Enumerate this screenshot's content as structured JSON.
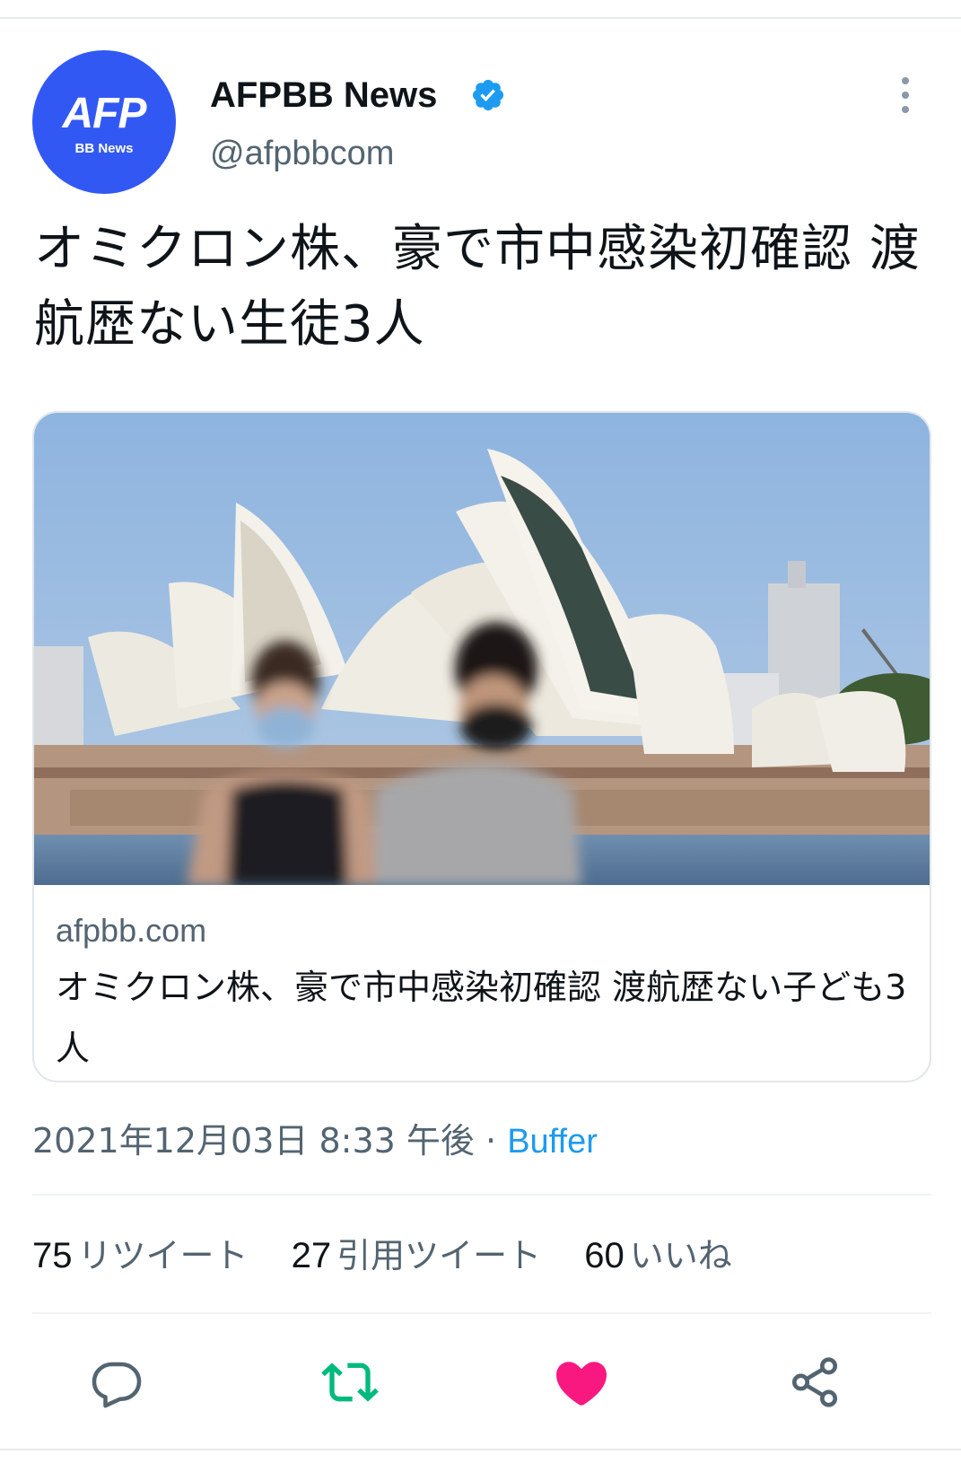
{
  "account": {
    "display_name": "AFPBB News",
    "handle": "@afpbbcom",
    "avatar_logo": "AFP",
    "avatar_sub": "BB News",
    "verified": true,
    "avatar_color": "#3258f4"
  },
  "tweet": {
    "text": "オミクロン株、豪で市中感染初確認 渡航歴ない生徒3人"
  },
  "card": {
    "domain": "afpbb.com",
    "title": "オミクロン株、豪で市中感染初確認 渡航歴ない子ども3人"
  },
  "meta": {
    "timestamp": "2021年12月03日 8:33 午後",
    "separator": "·",
    "source": "Buffer"
  },
  "stats": {
    "retweets": {
      "count": "75",
      "label": "リツイート"
    },
    "quotes": {
      "count": "27",
      "label": "引用ツイート"
    },
    "likes": {
      "count": "60",
      "label": "いいね"
    }
  },
  "actions": [
    {
      "name": "reply",
      "icon": "reply-icon",
      "color": "#536471"
    },
    {
      "name": "retweet",
      "icon": "retweet-icon",
      "color": "#00ba7c"
    },
    {
      "name": "like",
      "icon": "heart-icon",
      "color": "#f91880"
    },
    {
      "name": "share",
      "icon": "share-icon",
      "color": "#536471"
    }
  ],
  "colors": {
    "accent": "#1d9bf0",
    "text_secondary": "#536471",
    "retweet_active": "#00ba7c",
    "like_active": "#f91880"
  }
}
